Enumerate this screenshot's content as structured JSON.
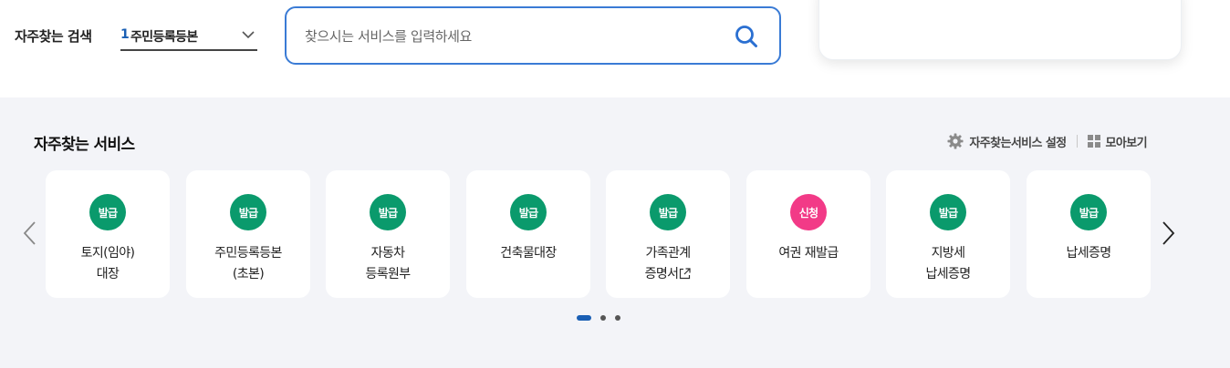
{
  "frequent_search": {
    "label": "자주찾는 검색",
    "select_rank": "1",
    "select_value": "주민등록등본"
  },
  "search": {
    "placeholder": "찾으시는 서비스를 입력하세요"
  },
  "services": {
    "title": "자주찾는 서비스",
    "settings_label": "자주찾는서비스 설정",
    "grid_label": "모아보기",
    "items": [
      {
        "badge": "발급",
        "line1": "토지(임야)",
        "line2": "대장"
      },
      {
        "badge": "발급",
        "line1": "주민등록등본",
        "line2": "(초본)"
      },
      {
        "badge": "발급",
        "line1": "자동차",
        "line2": "등록원부"
      },
      {
        "badge": "발급",
        "line1": "건축물대장",
        "line2": ""
      },
      {
        "badge": "발급",
        "line1": "가족관계",
        "line2": "증명서"
      },
      {
        "badge": "신청",
        "line1": "여권 재발급",
        "line2": ""
      },
      {
        "badge": "발급",
        "line1": "지방세",
        "line2": "납세증명"
      },
      {
        "badge": "발급",
        "line1": "납세증명",
        "line2": ""
      }
    ],
    "pagination": {
      "current": 1,
      "total": 3
    }
  },
  "colors": {
    "accent": "#1a5fb4",
    "badge_issue": "#0a9a6c",
    "badge_apply": "#f23a87",
    "section_bg": "#f3f4f8"
  },
  "icons": [
    "chevron-down-icon",
    "search-icon",
    "gear-icon",
    "grid-icon",
    "chevron-left-icon",
    "chevron-right-icon",
    "external-link-icon"
  ]
}
